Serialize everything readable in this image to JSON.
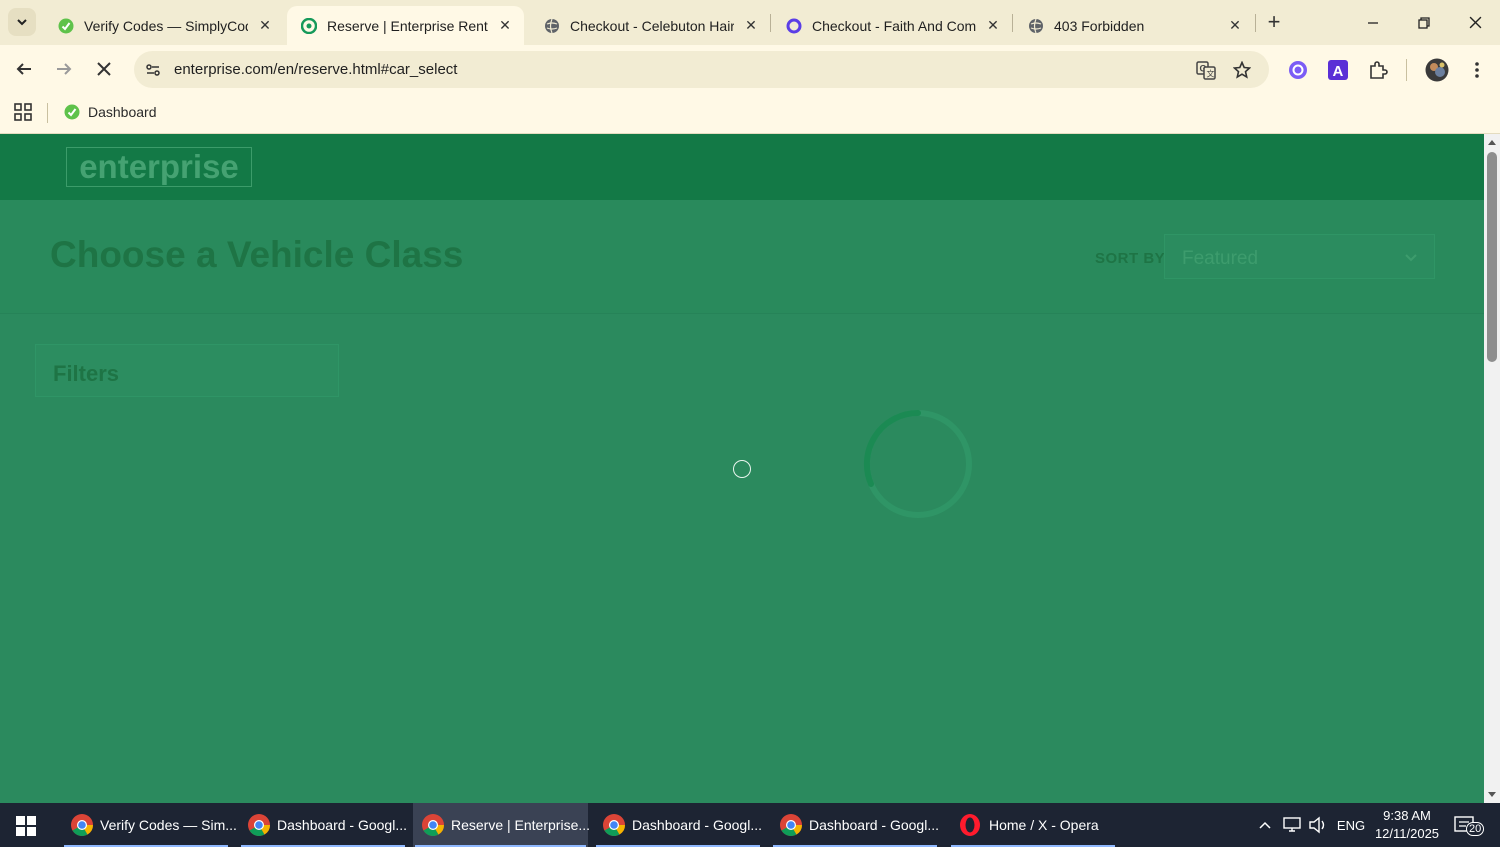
{
  "browser": {
    "tabs": [
      {
        "title": "Verify Codes — SimplyCodes",
        "active": false,
        "favicon": "simplycodes-icon"
      },
      {
        "title": "Reserve | Enterprise Rent-A-Car",
        "active": true,
        "favicon": "enterprise-icon"
      },
      {
        "title": "Checkout - Celebuton Hair",
        "active": false,
        "favicon": "globe-icon"
      },
      {
        "title": "Checkout - Faith And Comfort",
        "active": false,
        "favicon": "d-logo-icon"
      },
      {
        "title": "403 Forbidden",
        "active": false,
        "favicon": "globe-icon"
      }
    ],
    "url": "enterprise.com/en/reserve.html#car_select",
    "bookmarks": [
      {
        "label": "Dashboard",
        "favicon": "simplycodes-icon"
      }
    ]
  },
  "page": {
    "logo_text": "enterprise",
    "title": "Choose a Vehicle Class",
    "sort_label": "SORT BY",
    "sort_value": "Featured",
    "filters_label": "Filters",
    "colors": {
      "header": "#137946",
      "overlay": "#2b8a5e",
      "text_muted": "#1e7445"
    }
  },
  "taskbar": {
    "items": [
      {
        "label": "Verify Codes — Sim...",
        "icon": "chrome-icon",
        "active": false
      },
      {
        "label": "Dashboard - Googl...",
        "icon": "chrome-icon",
        "active": false
      },
      {
        "label": "Reserve | Enterprise...",
        "icon": "chrome-icon",
        "active": true
      },
      {
        "label": "Dashboard - Googl...",
        "icon": "chrome-icon",
        "active": false
      },
      {
        "label": "Dashboard - Googl...",
        "icon": "chrome-icon",
        "active": false
      },
      {
        "label": "Home / X - Opera",
        "icon": "opera-icon",
        "active": false
      }
    ],
    "language": "ENG",
    "time": "9:38 AM",
    "date": "12/11/2025",
    "notification_count": "20"
  }
}
